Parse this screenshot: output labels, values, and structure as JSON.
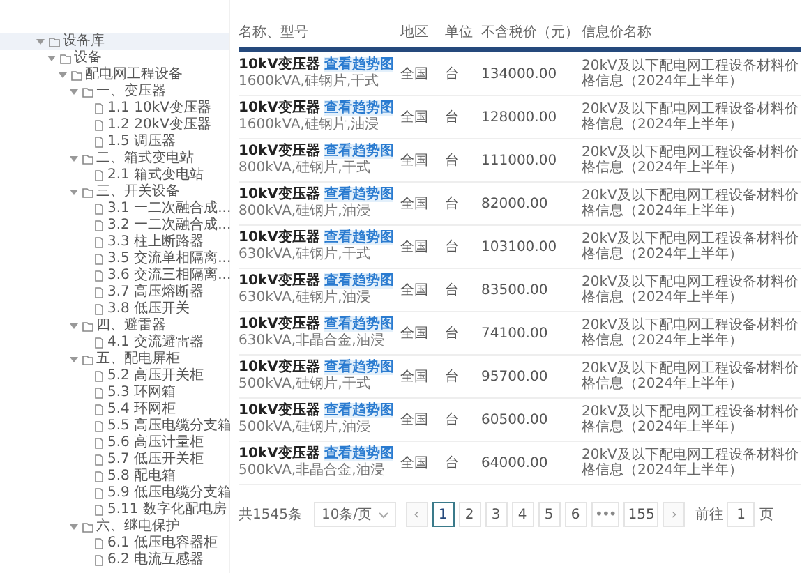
{
  "tree": [
    {
      "label": "设备库",
      "expanded": true,
      "children": [
        {
          "label": "设备",
          "expanded": true,
          "children": [
            {
              "label": "配电网工程设备",
              "expanded": true,
              "children": [
                {
                  "label": "一、变压器",
                  "expanded": true,
                  "children": [
                    {
                      "label": "1.1 10kV变压器"
                    },
                    {
                      "label": "1.2 20kV变压器"
                    },
                    {
                      "label": "1.5 调压器"
                    }
                  ]
                },
                {
                  "label": "二、箱式变电站",
                  "expanded": true,
                  "children": [
                    {
                      "label": "2.1 箱式变电站"
                    }
                  ]
                },
                {
                  "label": "三、开关设备",
                  "expanded": true,
                  "children": [
                    {
                      "label": "3.1 一二次融合成..."
                    },
                    {
                      "label": "3.2 一二次融合成..."
                    },
                    {
                      "label": "3.3 柱上断路器"
                    },
                    {
                      "label": "3.5 交流单相隔离..."
                    },
                    {
                      "label": "3.6 交流三相隔离..."
                    },
                    {
                      "label": "3.7 高压熔断器"
                    },
                    {
                      "label": "3.8 低压开关"
                    }
                  ]
                },
                {
                  "label": "四、避雷器",
                  "expanded": true,
                  "children": [
                    {
                      "label": "4.1 交流避雷器"
                    }
                  ]
                },
                {
                  "label": "五、配电屏柜",
                  "expanded": true,
                  "children": [
                    {
                      "label": "5.2 高压开关柜"
                    },
                    {
                      "label": "5.3 环网箱"
                    },
                    {
                      "label": "5.4 环网柜"
                    },
                    {
                      "label": "5.5 高压电缆分支箱"
                    },
                    {
                      "label": "5.6 高压计量柜"
                    },
                    {
                      "label": "5.7 低压开关柜"
                    },
                    {
                      "label": "5.8 配电箱"
                    },
                    {
                      "label": "5.9 低压电缆分支箱"
                    },
                    {
                      "label": "5.11 数字化配电房"
                    }
                  ]
                },
                {
                  "label": "六、继电保护",
                  "expanded": true,
                  "children": [
                    {
                      "label": "6.1 低压电容器柜"
                    },
                    {
                      "label": "6.2 电流互感器"
                    }
                  ]
                }
              ]
            }
          ]
        }
      ]
    }
  ],
  "table": {
    "columns": [
      "名称、型号",
      "地区",
      "单位",
      "不含税价（元）",
      "信息价名称"
    ],
    "rows": [
      {
        "name": "10kV变压器",
        "link": "查看趋势图",
        "spec": "1600kVA,硅钢片,干式",
        "region": "全国",
        "unit": "台",
        "price": "134000.00",
        "source": "20kV及以下配电网工程设备材料价格信息（2024年上半年）"
      },
      {
        "name": "10kV变压器",
        "link": "查看趋势图",
        "spec": "1600kVA,硅钢片,油浸",
        "region": "全国",
        "unit": "台",
        "price": "128000.00",
        "source": "20kV及以下配电网工程设备材料价格信息（2024年上半年）"
      },
      {
        "name": "10kV变压器",
        "link": "查看趋势图",
        "spec": "800kVA,硅钢片,干式",
        "region": "全国",
        "unit": "台",
        "price": "111000.00",
        "source": "20kV及以下配电网工程设备材料价格信息（2024年上半年）"
      },
      {
        "name": "10kV变压器",
        "link": "查看趋势图",
        "spec": "800kVA,硅钢片,油浸",
        "region": "全国",
        "unit": "台",
        "price": "82000.00",
        "source": "20kV及以下配电网工程设备材料价格信息（2024年上半年）"
      },
      {
        "name": "10kV变压器",
        "link": "查看趋势图",
        "spec": "630kVA,硅钢片,干式",
        "region": "全国",
        "unit": "台",
        "price": "103100.00",
        "source": "20kV及以下配电网工程设备材料价格信息（2024年上半年）"
      },
      {
        "name": "10kV变压器",
        "link": "查看趋势图",
        "spec": "630kVA,硅钢片,油浸",
        "region": "全国",
        "unit": "台",
        "price": "83500.00",
        "source": "20kV及以下配电网工程设备材料价格信息（2024年上半年）"
      },
      {
        "name": "10kV变压器",
        "link": "查看趋势图",
        "spec": "630kVA,非晶合金,油浸",
        "region": "全国",
        "unit": "台",
        "price": "74100.00",
        "source": "20kV及以下配电网工程设备材料价格信息（2024年上半年）"
      },
      {
        "name": "10kV变压器",
        "link": "查看趋势图",
        "spec": "500kVA,硅钢片,干式",
        "region": "全国",
        "unit": "台",
        "price": "95700.00",
        "source": "20kV及以下配电网工程设备材料价格信息（2024年上半年）"
      },
      {
        "name": "10kV变压器",
        "link": "查看趋势图",
        "spec": "500kVA,硅钢片,油浸",
        "region": "全国",
        "unit": "台",
        "price": "60500.00",
        "source": "20kV及以下配电网工程设备材料价格信息（2024年上半年）"
      },
      {
        "name": "10kV变压器",
        "link": "查看趋势图",
        "spec": "500kVA,非晶合金,油浸",
        "region": "全国",
        "unit": "台",
        "price": "64000.00",
        "source": "20kV及以下配电网工程设备材料价格信息（2024年上半年）"
      }
    ]
  },
  "pagination": {
    "total": "共1545条",
    "page_size": "10条/页",
    "items": [
      {
        "kind": "prev",
        "label": "‹",
        "selected": false
      },
      {
        "kind": "page",
        "label": "1",
        "selected": true
      },
      {
        "kind": "page",
        "label": "2",
        "selected": false
      },
      {
        "kind": "page",
        "label": "3",
        "selected": false
      },
      {
        "kind": "page",
        "label": "4",
        "selected": false
      },
      {
        "kind": "page",
        "label": "5",
        "selected": false
      },
      {
        "kind": "page",
        "label": "6",
        "selected": false
      },
      {
        "kind": "more",
        "label": "•••",
        "selected": false
      },
      {
        "kind": "page",
        "label": "155",
        "selected": false
      },
      {
        "kind": "next",
        "label": "›",
        "selected": false
      }
    ],
    "goto_label": "前往",
    "goto_value": "1",
    "goto_suffix": "页"
  }
}
